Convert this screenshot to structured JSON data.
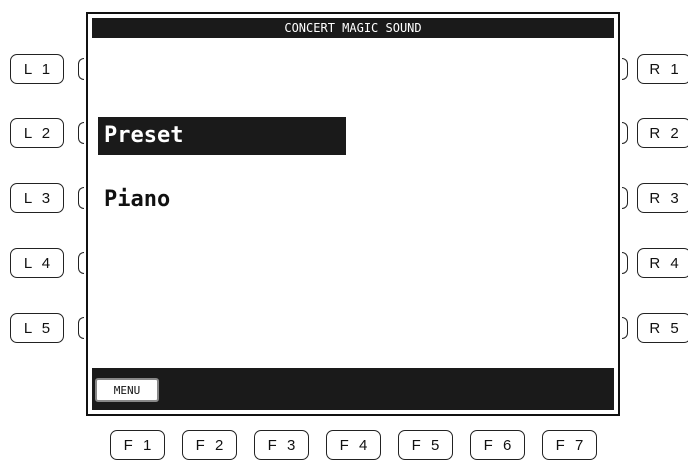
{
  "screen": {
    "title": "CONCERT MAGIC SOUND",
    "items": [
      {
        "label": "Preset",
        "selected": true
      },
      {
        "label": "Piano",
        "selected": false
      }
    ],
    "menu_label": "MENU"
  },
  "left_buttons": [
    "L 1",
    "L 2",
    "L 3",
    "L 4",
    "L 5"
  ],
  "right_buttons": [
    "R 1",
    "R 2",
    "R 3",
    "R 4",
    "R 5"
  ],
  "function_buttons": [
    "F 1",
    "F 2",
    "F 3",
    "F 4",
    "F 5",
    "F 6",
    "F 7"
  ]
}
